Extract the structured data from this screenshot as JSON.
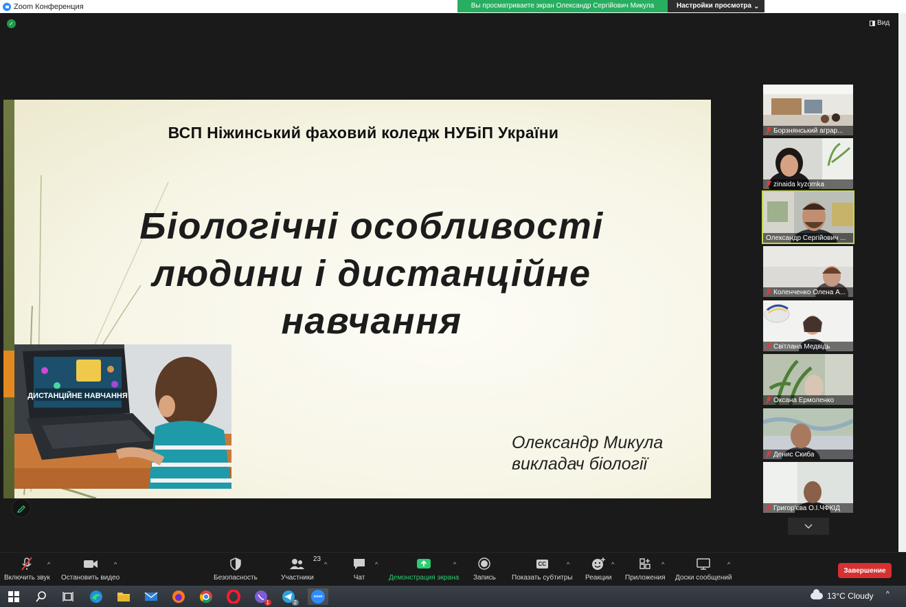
{
  "window": {
    "title": "Zoom Конференция"
  },
  "share_banner": {
    "viewing_text": "Вы просматриваете экран Олександр Сергійович Микула",
    "view_options_label": "Настройки просмотра"
  },
  "top_right": {
    "view_label": "Вид"
  },
  "slide": {
    "header": "ВСП Ніжинський фаховий коледж НУБіП України",
    "title_lines": [
      "Біологічні особливості",
      "людини і дистанційне",
      "навчання"
    ],
    "author_lines": [
      "Олександр Микула",
      "викладач біології"
    ],
    "photo_caption": "ДИСТАНЦІЙНЕ НАВЧАННЯ"
  },
  "participants": [
    {
      "name": "Борзнянський аграр...",
      "muted": true,
      "active": false
    },
    {
      "name": "zinaida kyzomka",
      "muted": true,
      "active": false
    },
    {
      "name": "Олександр Сергійович ...",
      "muted": false,
      "active": true
    },
    {
      "name": "Коленченко Олена А...",
      "muted": true,
      "active": false
    },
    {
      "name": "Світлана Медвідь",
      "muted": true,
      "active": false
    },
    {
      "name": "Оксана Ермоленко",
      "muted": true,
      "active": false
    },
    {
      "name": "Денис Скиба",
      "muted": true,
      "active": false
    },
    {
      "name": "Григор'єва О.І.ЧФКІД",
      "muted": true,
      "active": false
    }
  ],
  "toolbar": {
    "unmute_label": "Включить звук",
    "stop_video_label": "Остановить видео",
    "security_label": "Безопасность",
    "participants_label": "Участники",
    "participants_count": "23",
    "chat_label": "Чат",
    "share_label": "Демонстрация экрана",
    "record_label": "Запись",
    "captions_label": "Показать субтитры",
    "captions_icon_text": "CC",
    "reactions_label": "Реакции",
    "apps_label": "Приложения",
    "whiteboards_label": "Доски сообщений",
    "end_label": "Завершение"
  },
  "taskbar": {
    "viber_badge": "1",
    "telegram_badge": "2",
    "zoom_icon_text": "zoom",
    "weather_text": "13°C  Cloudy"
  },
  "colors": {
    "share_green": "#27ae60",
    "end_red": "#d63031",
    "active_outline": "#c3d94b",
    "slide_bar": "#6f7a43",
    "slide_accent": "#e4891f"
  }
}
